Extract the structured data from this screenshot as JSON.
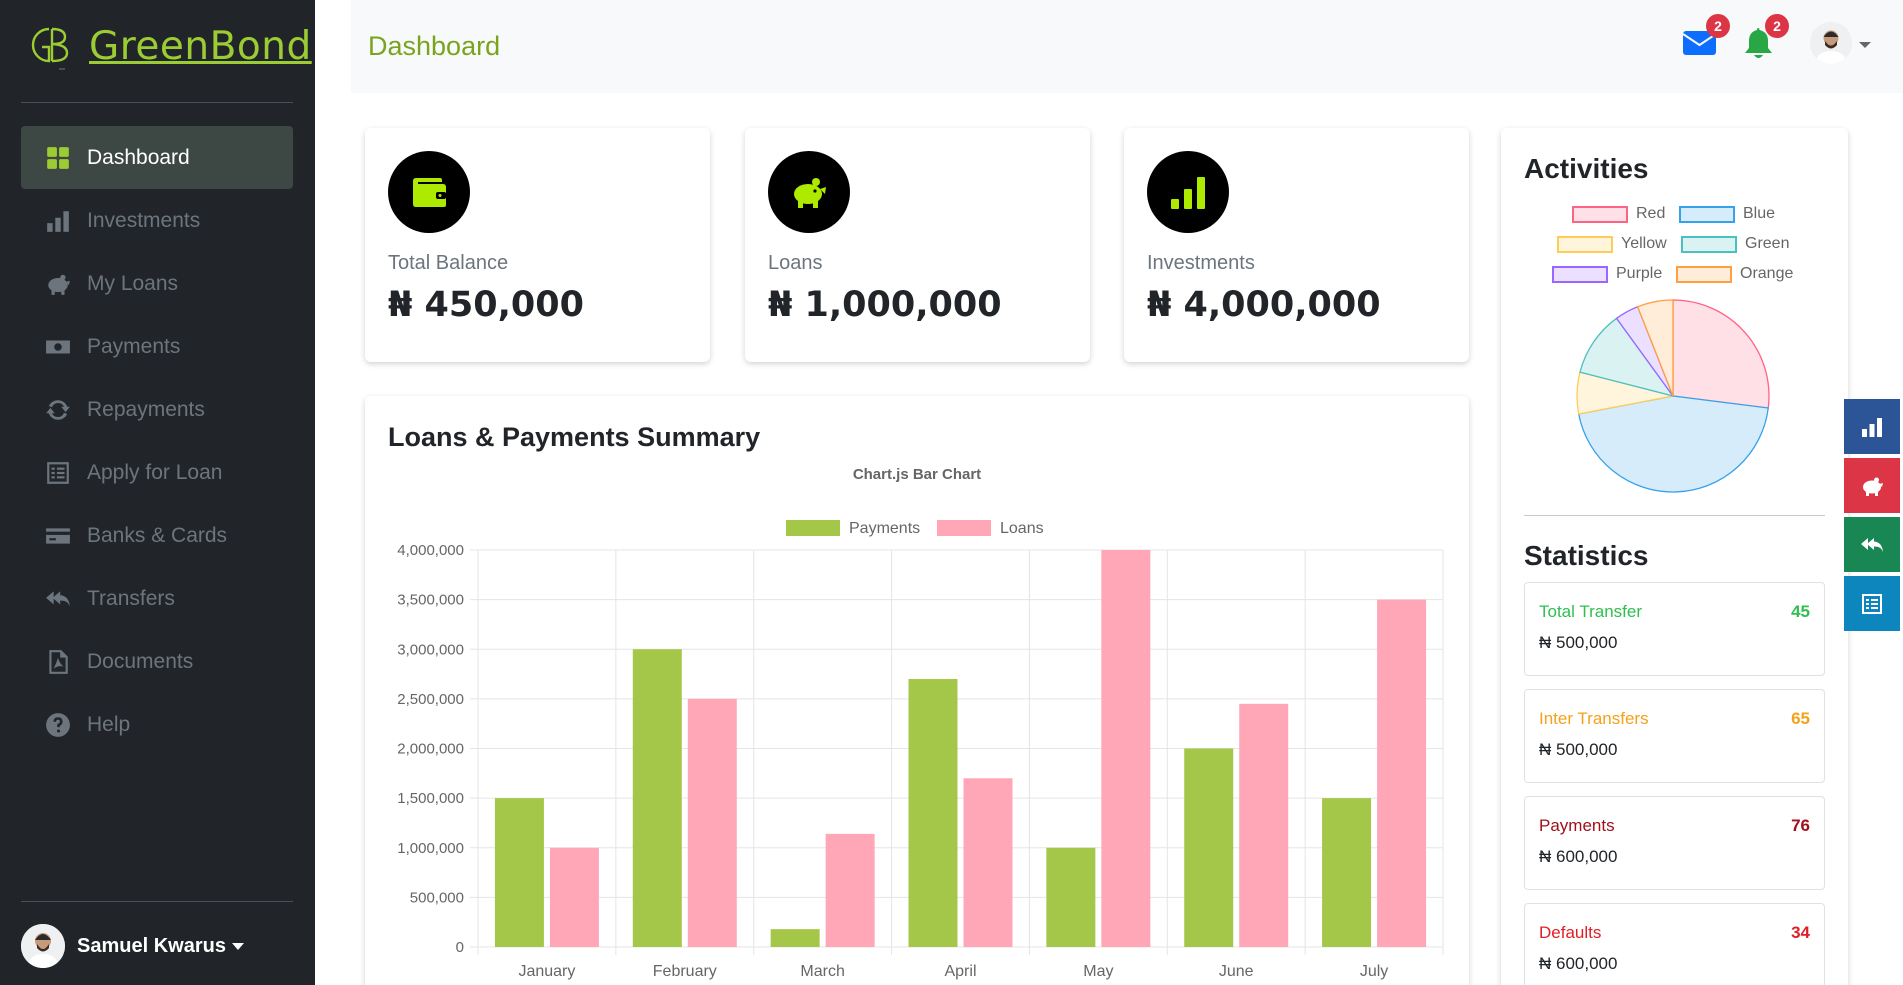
{
  "brand": {
    "name": "GreenBond",
    "logo_text": "GB"
  },
  "sidebar": {
    "items": [
      {
        "label": "Dashboard",
        "icon": "grid-icon",
        "active": true
      },
      {
        "label": "Investments",
        "icon": "bar-chart-icon"
      },
      {
        "label": "My Loans",
        "icon": "piggy-bank-icon"
      },
      {
        "label": "Payments",
        "icon": "money-bill-icon"
      },
      {
        "label": "Repayments",
        "icon": "sync-icon"
      },
      {
        "label": "Apply for Loan",
        "icon": "form-icon"
      },
      {
        "label": "Banks & Cards",
        "icon": "credit-card-icon"
      },
      {
        "label": "Transfers",
        "icon": "reply-all-icon"
      },
      {
        "label": "Documents",
        "icon": "pdf-file-icon"
      },
      {
        "label": "Help",
        "icon": "question-circle-icon"
      }
    ],
    "user": {
      "name": "Samuel Kwarus"
    }
  },
  "topbar": {
    "title": "Dashboard",
    "mail_badge": "2",
    "bell_badge": "2"
  },
  "stats": [
    {
      "label": "Total Balance",
      "value": "₦ 450,000",
      "icon": "wallet-icon"
    },
    {
      "label": "Loans",
      "value": "₦ 1,000,000",
      "icon": "piggy-bank-icon"
    },
    {
      "label": "Investments",
      "value": "₦ 4,000,000",
      "icon": "signal-icon"
    }
  ],
  "summary": {
    "title": "Loans & Payments Summary"
  },
  "chart_data": [
    {
      "type": "bar",
      "title": "Chart.js Bar Chart",
      "categories": [
        "January",
        "February",
        "March",
        "April",
        "May",
        "June",
        "July"
      ],
      "series": [
        {
          "name": "Payments",
          "values": [
            1500000,
            3000000,
            180000,
            2700000,
            1000000,
            2000000,
            1500000
          ],
          "color": "#a4c749"
        },
        {
          "name": "Loans",
          "values": [
            1000000,
            2500000,
            1140000,
            1700000,
            4000000,
            2450000,
            3500000
          ],
          "color": "#ffa7b7"
        }
      ],
      "ylim": [
        0,
        4000000
      ],
      "yticks": [
        "0",
        "500,000",
        "1,000,000",
        "1,500,000",
        "2,000,000",
        "2,500,000",
        "3,000,000",
        "3,500,000",
        "4,000,000"
      ],
      "grid": true,
      "legend": "top"
    },
    {
      "type": "pie",
      "title": "",
      "categories": [
        "Red",
        "Blue",
        "Yellow",
        "Green",
        "Purple",
        "Orange"
      ],
      "values": [
        27,
        45,
        7,
        11,
        4,
        6
      ],
      "fills": [
        "#ffe0e6",
        "#d7ecfb",
        "#fff5dd",
        "#dbf2f2",
        "#ebe0ff",
        "#ffecd9"
      ],
      "borders": [
        "#ff6384",
        "#36a2eb",
        "#ffcd56",
        "#4bc0c0",
        "#9966ff",
        "#ff9f40"
      ],
      "legend": "top"
    }
  ],
  "activities": {
    "title": "Activities"
  },
  "statistics": {
    "title": "Statistics",
    "items": [
      {
        "label": "Total Transfer",
        "count": "45",
        "amount": "₦ 500,000",
        "color": "#2fbf4f"
      },
      {
        "label": "Inter Transfers",
        "count": "65",
        "amount": "₦ 500,000",
        "color": "#f5a11b"
      },
      {
        "label": "Payments",
        "count": "76",
        "amount": "₦ 600,000",
        "color": "#a0101c"
      },
      {
        "label": "Defaults",
        "count": "34",
        "amount": "₦ 600,000",
        "color": "#e01e25"
      }
    ]
  },
  "floating": [
    {
      "icon": "bar-chart-icon",
      "color": "#2b5596"
    },
    {
      "icon": "piggy-bank-icon",
      "color": "#dc3545"
    },
    {
      "icon": "reply-all-icon",
      "color": "#198754"
    },
    {
      "icon": "form-icon",
      "color": "#0d86bd"
    }
  ]
}
